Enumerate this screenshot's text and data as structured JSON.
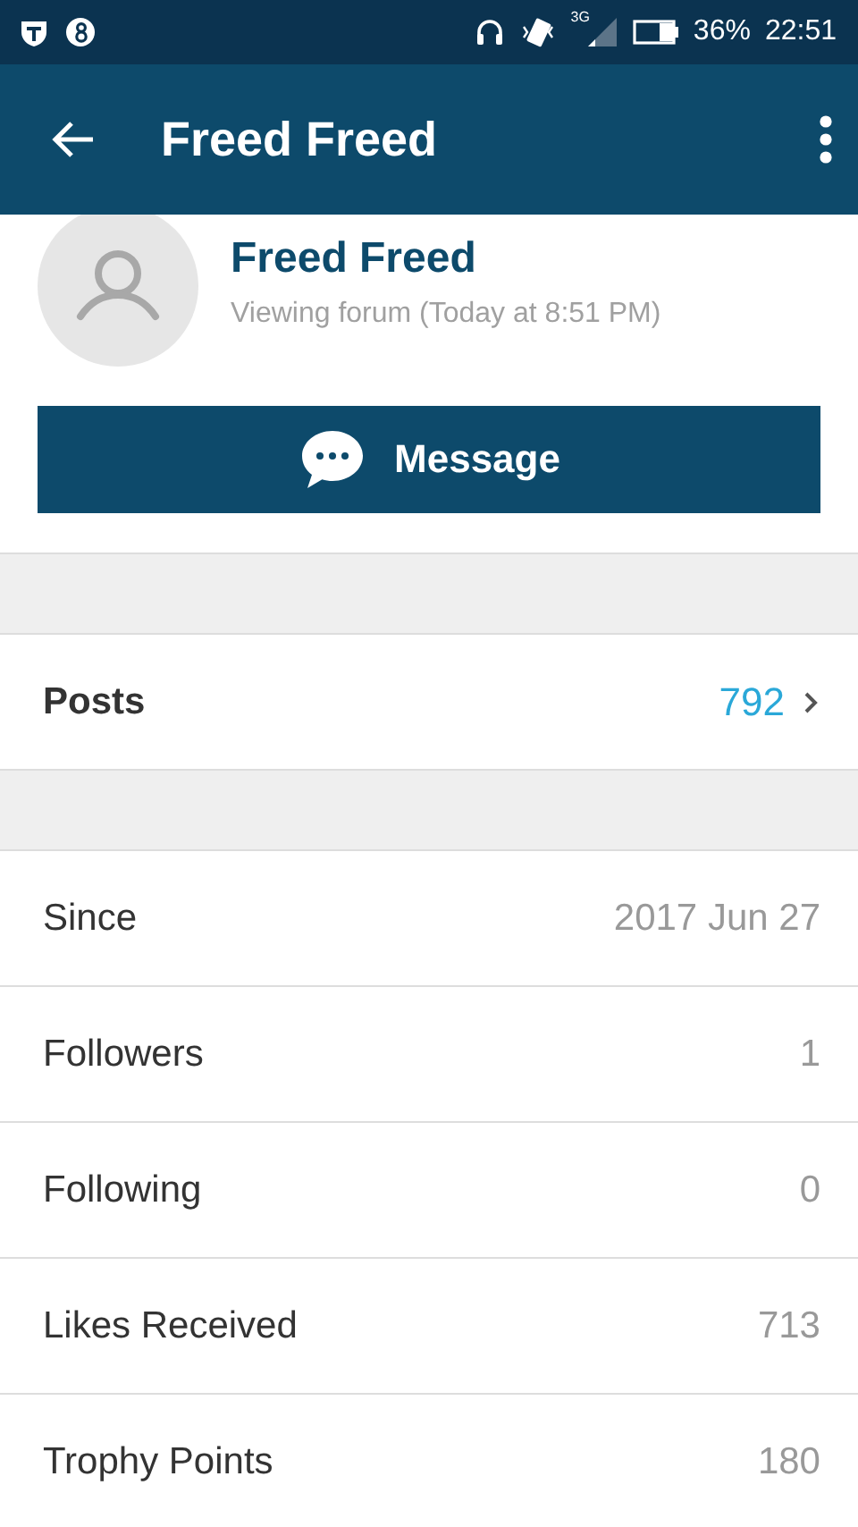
{
  "status_bar": {
    "network": "3G",
    "battery": "36%",
    "time": "22:51"
  },
  "app_bar": {
    "title": "Freed Freed"
  },
  "profile": {
    "name": "Freed Freed",
    "activity": "Viewing forum (Today at 8:51 PM)",
    "button": "Message"
  },
  "posts": {
    "label": "Posts",
    "value": "792"
  },
  "stats": [
    {
      "label": "Since",
      "value": "2017 Jun 27"
    },
    {
      "label": "Followers",
      "value": "1"
    },
    {
      "label": "Following",
      "value": "0"
    },
    {
      "label": "Likes Received",
      "value": "713"
    },
    {
      "label": "Trophy Points",
      "value": "180"
    }
  ]
}
